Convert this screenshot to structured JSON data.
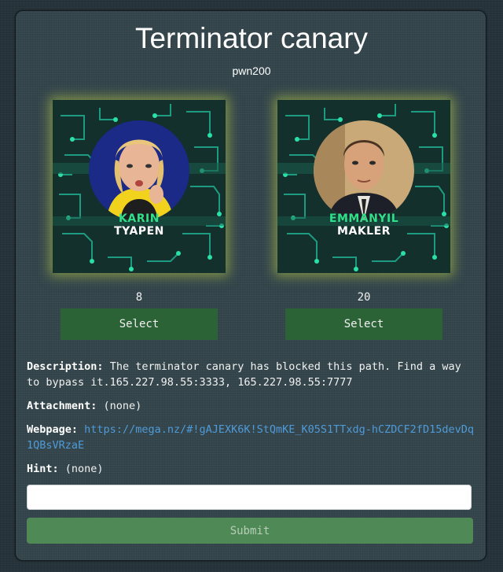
{
  "challenge": {
    "title": "Terminator canary",
    "category_points": "pwn200"
  },
  "options": [
    {
      "name_line1": "KARIN",
      "name_line2": "TYAPEN",
      "count": "8",
      "button_label": "Select"
    },
    {
      "name_line1": "EMMANYIL",
      "name_line2": "MAKLER",
      "count": "20",
      "button_label": "Select"
    }
  ],
  "details": {
    "description_label": "Description:",
    "description_text": "The terminator canary has blocked this path. Find a way to bypass it.165.227.98.55:3333, 165.227.98.55:7777",
    "attachment_label": "Attachment:",
    "attachment_value": "(none)",
    "webpage_label": "Webpage:",
    "webpage_url": "https://mega.nz/#!gAJEXK6K!StQmKE_K05S1TTxdg-hCZDCF2fD15devDq1QBsVRzaE",
    "hint_label": "Hint:",
    "hint_value": "(none)"
  },
  "form": {
    "flag_placeholder": "",
    "submit_label": "Submit"
  },
  "colors": {
    "accent_green": "#2b6236",
    "name_green": "#2fe08a",
    "link_blue": "#4f9bd9",
    "card_glow": "#bed246"
  }
}
